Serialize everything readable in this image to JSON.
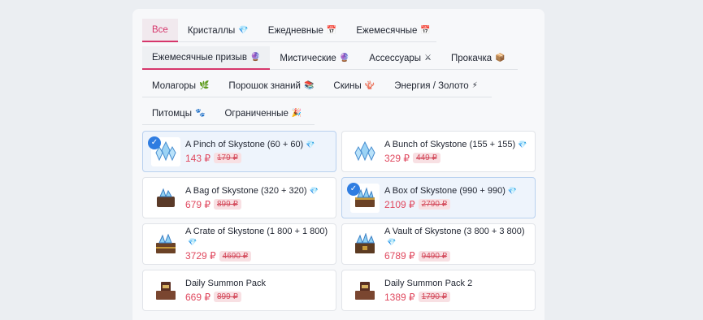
{
  "tabs": {
    "row1": [
      {
        "label": "Все",
        "icon": ""
      },
      {
        "label": "Кристаллы",
        "icon": "💎"
      },
      {
        "label": "Ежедневные",
        "icon": "📅"
      },
      {
        "label": "Ежемесячные",
        "icon": "📅"
      }
    ],
    "row2": [
      {
        "label": "Ежемесячные призыв",
        "icon": "🔮"
      },
      {
        "label": "Мистические",
        "icon": "🔮"
      },
      {
        "label": "Ассессуары",
        "icon": "⚔"
      },
      {
        "label": "Прокачка",
        "icon": "📦"
      }
    ],
    "row3": [
      {
        "label": "Молагоры",
        "icon": "🌿"
      },
      {
        "label": "Порошок знаний",
        "icon": "📚"
      },
      {
        "label": "Скины",
        "icon": "🪸"
      },
      {
        "label": "Энергия / Золото",
        "icon": "⚡"
      }
    ],
    "row4": [
      {
        "label": "Питомцы",
        "icon": "🐾"
      },
      {
        "label": "Ограниченные",
        "icon": "🎉"
      }
    ]
  },
  "colors": {
    "accent": "#d6366b",
    "price": "#e0495f",
    "selected_check": "#2f7de1"
  },
  "products": [
    {
      "title": "A Pinch of Skystone (60 + 60)",
      "gem": "💎",
      "price": "143 ₽",
      "old_price": "179 ₽",
      "selected": true,
      "icon": "crystal-cluster-icon"
    },
    {
      "title": "A Bunch of Skystone (155 + 155)",
      "gem": "💎",
      "price": "329 ₽",
      "old_price": "449 ₽",
      "selected": false,
      "icon": "crystal-cluster-icon"
    },
    {
      "title": "A Bag of Skystone (320 + 320)",
      "gem": "💎",
      "price": "679 ₽",
      "old_price": "899 ₽",
      "selected": false,
      "icon": "crystal-bag-icon"
    },
    {
      "title": "A Box of Skystone (990 + 990)",
      "gem": "💎",
      "price": "2109 ₽",
      "old_price": "2790 ₽",
      "selected": true,
      "icon": "crystal-chest-icon"
    },
    {
      "title": "A Crate of Skystone (1 800 + 1 800)",
      "gem": "💎",
      "price": "3729 ₽",
      "old_price": "4690 ₽",
      "selected": false,
      "icon": "crystal-crate-icon"
    },
    {
      "title": "A Vault of Skystone (3 800 + 3 800)",
      "gem": "💎",
      "price": "6789 ₽",
      "old_price": "9490 ₽",
      "selected": false,
      "icon": "crystal-vault-icon"
    },
    {
      "title": "Daily Summon Pack",
      "gem": "",
      "price": "669 ₽",
      "old_price": "899 ₽",
      "selected": false,
      "icon": "summon-chest-icon"
    },
    {
      "title": "Daily Summon Pack 2",
      "gem": "",
      "price": "1389 ₽",
      "old_price": "1790 ₽",
      "selected": false,
      "icon": "summon-chest-icon"
    }
  ]
}
